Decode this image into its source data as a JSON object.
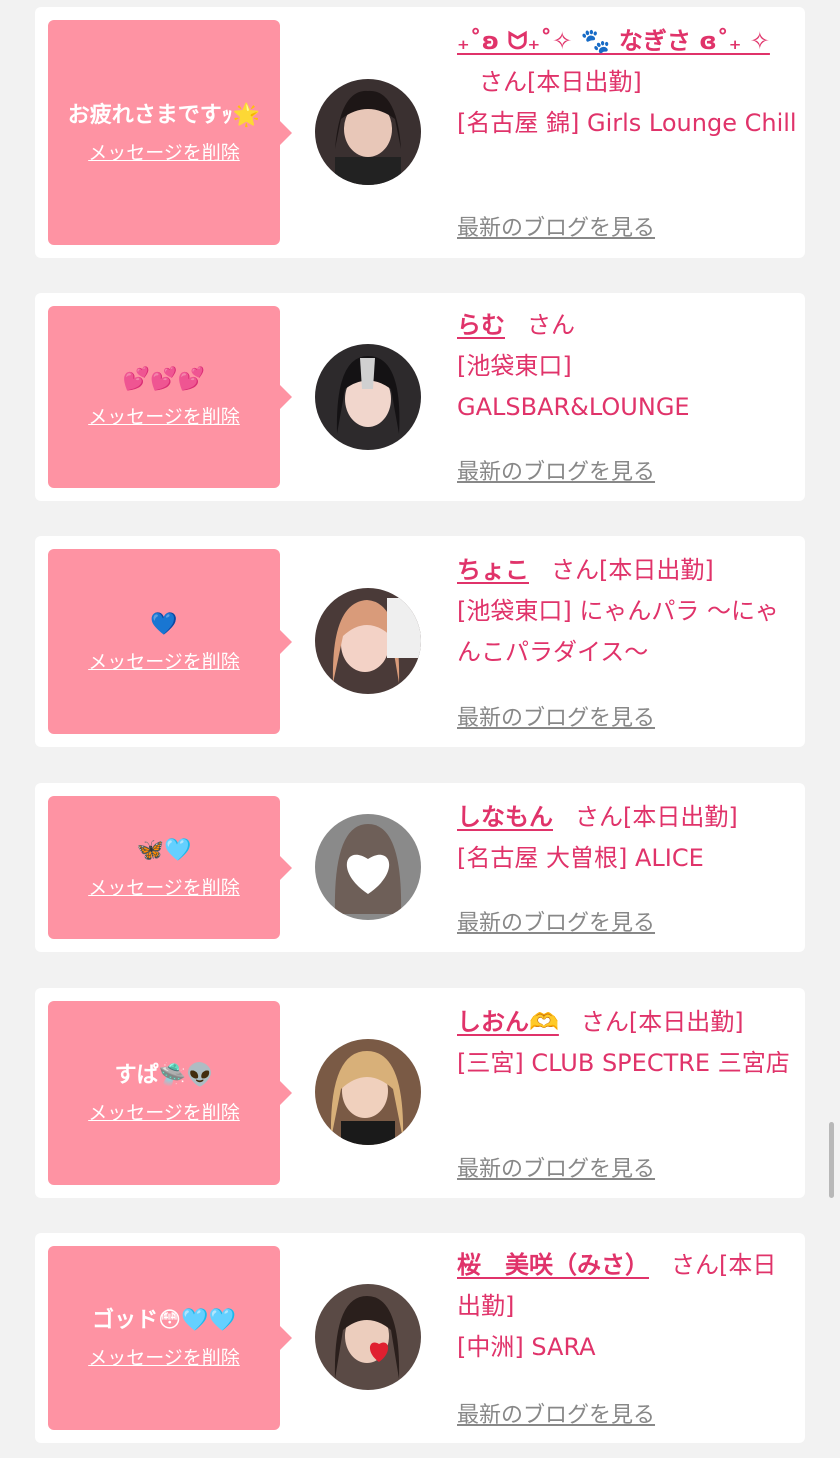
{
  "delete_label": "メッセージを削除",
  "blog_label": "最新のブログを見る",
  "san_label": "さん",
  "cards": [
    {
      "message": "お疲れさまですｯ🌟",
      "name": "₊˚ʚ ᗢ₊˚✧ 🐾 なぎさ ɞ˚₊ ✧",
      "status": "[本日出勤]",
      "shop": "[名古屋 錦] Girls Lounge Chill",
      "avatar_icon": "girl-photo-avatar"
    },
    {
      "message": "💕💕💕",
      "name": "らむ",
      "status": "",
      "shop": "[池袋東口] GALSBAR&LOUNGE",
      "avatar_icon": "girl-photo-avatar"
    },
    {
      "message": "💙",
      "name": "ちょこ",
      "status": "[本日出勤]",
      "shop": "[池袋東口] にゃんパラ 〜にゃんこパラダイス〜",
      "avatar_icon": "girl-photo-avatar"
    },
    {
      "message": "🦋🩵",
      "name": "しなもん",
      "status": "[本日出勤]",
      "shop": "[名古屋 大曽根] ALICE",
      "avatar_icon": "heart-face-avatar"
    },
    {
      "message": "すぱ🛸👽",
      "name": "しおん🫶",
      "status": "[本日出勤]",
      "shop": "[三宮] CLUB SPECTRE 三宮店",
      "avatar_icon": "girl-photo-avatar"
    },
    {
      "message": "ゴッド😳🩵🩵",
      "name": "桜　美咲（みさ）",
      "status": "[本日出勤]",
      "shop": "[中洲] SARA",
      "avatar_icon": "girl-photo-avatar"
    }
  ],
  "colors": {
    "accent": "#e0336a",
    "message_bg": "#fe93a3",
    "page_bg": "#f2f2f2",
    "link_gray": "#888888"
  }
}
